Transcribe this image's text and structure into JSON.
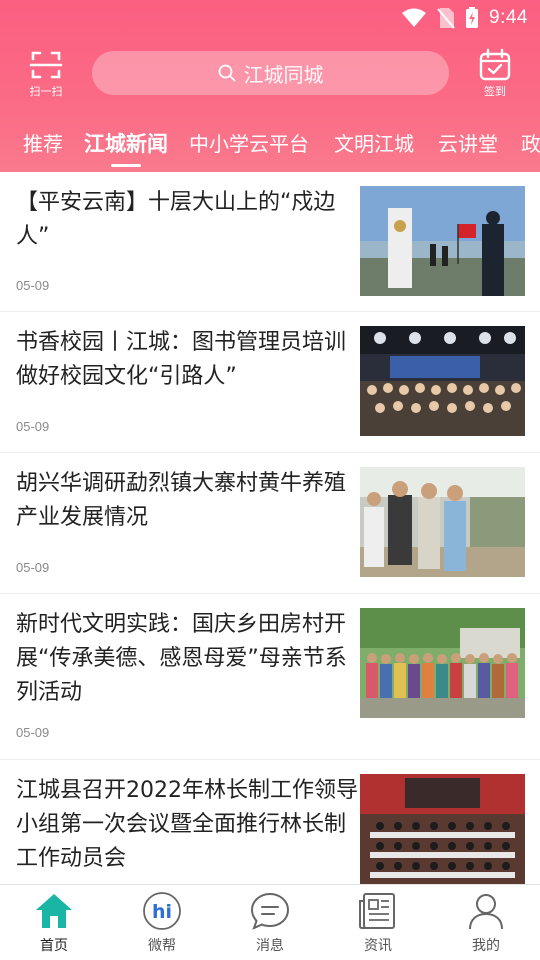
{
  "status_bar": {
    "time": "9:44"
  },
  "header": {
    "scan_label": "扫一扫",
    "search_placeholder": "江城同城",
    "checkin_label": "签到",
    "accent_color": "#fb6b85"
  },
  "tabs": [
    {
      "label": "推荐",
      "active": false
    },
    {
      "label": "江城新闻",
      "active": true
    },
    {
      "label": "中小学云平台",
      "active": false
    },
    {
      "label": "文明江城",
      "active": false
    },
    {
      "label": "云讲堂",
      "active": false
    },
    {
      "label": "政",
      "active": false
    }
  ],
  "news": [
    {
      "title": "【平安云南】十层大山上的“戍边人”",
      "date": "05-09",
      "thumb": "border-patrol-photo"
    },
    {
      "title": "书香校园丨江城：图书管理员培训做好校园文化“引路人”",
      "date": "05-09",
      "thumb": "training-group-photo"
    },
    {
      "title": "胡兴华调研勐烈镇大寨村黄牛养殖产业发展情况",
      "date": "05-09",
      "thumb": "cattle-farm-visit-photo"
    },
    {
      "title": "新时代文明实践：国庆乡田房村开展“传承美德、感恩母爱”母亲节系列活动",
      "date": "05-09",
      "thumb": "village-group-photo"
    },
    {
      "title": "江城县召开2022年林长制工作领导小组第一次会议暨全面推行林长制工作动员会",
      "date": "",
      "thumb": "meeting-hall-photo"
    }
  ],
  "bottom_nav": [
    {
      "label": "首页",
      "icon": "home-icon",
      "active": true,
      "color": "#19b6a5"
    },
    {
      "label": "微帮",
      "icon": "hi-icon",
      "active": false,
      "badge_text": "hi"
    },
    {
      "label": "消息",
      "icon": "chat-icon",
      "active": false
    },
    {
      "label": "资讯",
      "icon": "news-icon",
      "active": false
    },
    {
      "label": "我的",
      "icon": "person-icon",
      "active": false
    }
  ]
}
